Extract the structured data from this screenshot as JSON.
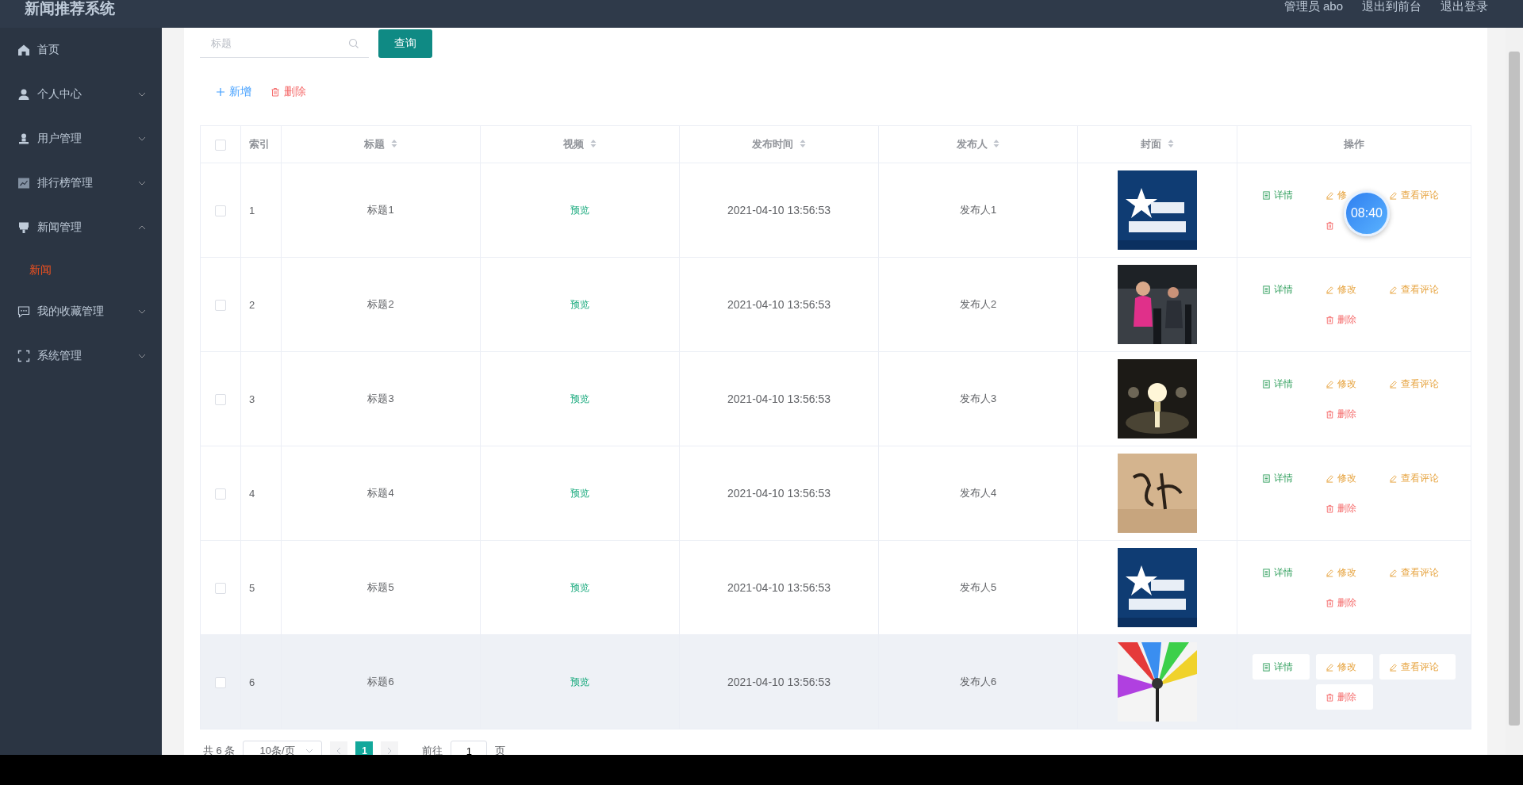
{
  "app_title": "新闻推荐系统",
  "header_links": [
    {
      "text": "管理员 abo"
    },
    {
      "text": "退出到前台"
    },
    {
      "text": "退出登录"
    }
  ],
  "sidebar": {
    "items": [
      {
        "label": "首页"
      },
      {
        "label": "个人中心",
        "expanded": false
      },
      {
        "label": "用户管理",
        "expanded": false
      },
      {
        "label": "排行榜管理",
        "expanded": false
      },
      {
        "label": "新闻管理",
        "expanded": true,
        "children": [
          {
            "label": "新闻",
            "selected": true
          }
        ]
      },
      {
        "label": "我的收藏管理",
        "expanded": false
      },
      {
        "label": "系统管理",
        "expanded": false
      }
    ]
  },
  "search": {
    "placeholder": "标题",
    "button": "查询"
  },
  "toolbar": [
    {
      "label": "新增",
      "kind": "add"
    },
    {
      "label": "删除",
      "kind": "delete"
    }
  ],
  "table": {
    "select_all": {
      "checked": false
    },
    "columns": [
      {
        "label": "索引",
        "sortable": false
      },
      {
        "label": "标题",
        "sortable": true
      },
      {
        "label": "视频",
        "sortable": true
      },
      {
        "label": "发布时间",
        "sortable": true
      },
      {
        "label": "发布人",
        "sortable": true
      },
      {
        "label": "封面",
        "sortable": true
      },
      {
        "label": "操作",
        "sortable": false
      }
    ],
    "rows": [
      {
        "checked": false,
        "highlighted": false,
        "index": "1",
        "title": "标题1",
        "video": "预览",
        "time": "2021-04-10 13:56:53",
        "publisher": "发布人1",
        "actions": [
          {
            "label": "详情",
            "kind": "detail"
          },
          {
            "label": "修",
            "kind": "edit"
          },
          {
            "label": "查看评论",
            "kind": "edit"
          },
          {
            "kind": "delete"
          }
        ]
      },
      {
        "checked": false,
        "highlighted": false,
        "index": "2",
        "title": "标题2",
        "video": "预览",
        "time": "2021-04-10 13:56:53",
        "publisher": "发布人2",
        "actions": [
          {
            "label": "详情",
            "kind": "detail"
          },
          {
            "label": "修改",
            "kind": "edit"
          },
          {
            "label": "查看评论",
            "kind": "edit"
          },
          {
            "label": "删除",
            "kind": "delete"
          }
        ]
      },
      {
        "checked": false,
        "highlighted": false,
        "index": "3",
        "title": "标题3",
        "video": "预览",
        "time": "2021-04-10 13:56:53",
        "publisher": "发布人3",
        "actions": [
          {
            "label": "详情",
            "kind": "detail"
          },
          {
            "label": "修改",
            "kind": "edit"
          },
          {
            "label": "查看评论",
            "kind": "edit"
          },
          {
            "label": "删除",
            "kind": "delete"
          }
        ]
      },
      {
        "checked": false,
        "highlighted": false,
        "index": "4",
        "title": "标题4",
        "video": "预览",
        "time": "2021-04-10 13:56:53",
        "publisher": "发布人4",
        "actions": [
          {
            "label": "详情",
            "kind": "detail"
          },
          {
            "label": "修改",
            "kind": "edit"
          },
          {
            "label": "查看评论",
            "kind": "edit"
          },
          {
            "label": "删除",
            "kind": "delete"
          }
        ]
      },
      {
        "checked": false,
        "highlighted": false,
        "index": "5",
        "title": "标题5",
        "video": "预览",
        "time": "2021-04-10 13:56:53",
        "publisher": "发布人5",
        "actions": [
          {
            "label": "详情",
            "kind": "detail"
          },
          {
            "label": "修改",
            "kind": "edit"
          },
          {
            "label": "查看评论",
            "kind": "edit"
          },
          {
            "label": "删除",
            "kind": "delete"
          }
        ]
      },
      {
        "checked": false,
        "highlighted": true,
        "index": "6",
        "title": "标题6",
        "video": "预览",
        "time": "2021-04-10 13:56:53",
        "publisher": "发布人6",
        "actions": [
          {
            "label": "详情",
            "kind": "detail"
          },
          {
            "label": "修改",
            "kind": "edit"
          },
          {
            "label": "查看评论",
            "kind": "edit"
          },
          {
            "label": "删除",
            "kind": "delete"
          }
        ]
      }
    ]
  },
  "pagination": {
    "total": "共 6 条",
    "page_size": "10条/页",
    "pages": [
      {
        "label": "1",
        "selected": true
      }
    ],
    "goto_label": "前往",
    "goto_value": "1",
    "goto_suffix": "页"
  },
  "timer": "08:40"
}
